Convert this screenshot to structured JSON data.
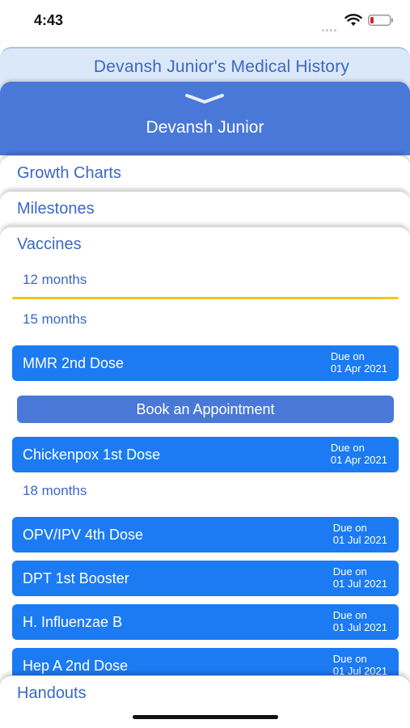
{
  "status_bar": {
    "time": "4:43",
    "icons": [
      "signal-dots-icon",
      "wifi-icon",
      "battery-low-icon"
    ],
    "battery_color": "#e02020"
  },
  "header": {
    "title": "Devansh Junior's Medical History"
  },
  "profile": {
    "name": "Devansh Junior",
    "collapse_icon": "chevron-down-icon"
  },
  "sections": {
    "growth_charts": "Growth Charts",
    "milestones": "Milestones",
    "vaccines": "Vaccines",
    "handouts": "Handouts"
  },
  "vaccines": {
    "age_groups": [
      "12 months",
      "15 months",
      "18 months"
    ],
    "selected_age": "12 months",
    "book_button": "Book an Appointment",
    "items": [
      {
        "name": "MMR 2nd Dose",
        "due_label": "Due on",
        "due_date": "01 Apr 2021"
      },
      {
        "name": "Chickenpox 1st Dose",
        "due_label": "Due on",
        "due_date": "01 Apr 2021"
      },
      {
        "name": "OPV/IPV 4th Dose",
        "due_label": "Due on",
        "due_date": "01 Jul 2021"
      },
      {
        "name": "DPT 1st Booster",
        "due_label": "Due on",
        "due_date": "01 Jul 2021"
      },
      {
        "name": "H. Influenzae B",
        "due_label": "Due on",
        "due_date": "01 Jul 2021"
      },
      {
        "name": "Hep A 2nd Dose",
        "due_label": "Due on",
        "due_date": "01 Jul 2021"
      }
    ]
  },
  "colors": {
    "accent": "#4a78d8",
    "vaccine_row": "#1c7bf2",
    "text_link": "#3b68c4",
    "selected_underline": "#f5c518",
    "header_bg": "#dbe8f9"
  }
}
